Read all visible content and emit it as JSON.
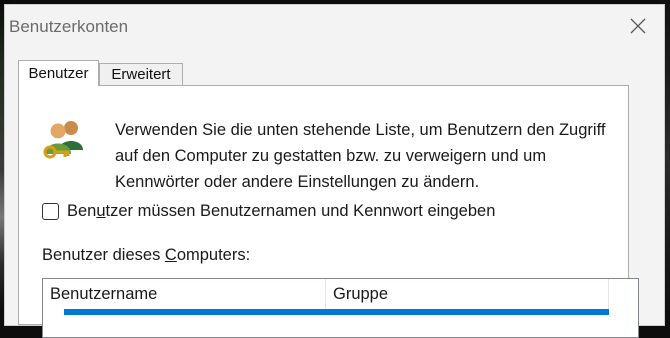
{
  "window": {
    "title": "Benutzerkonten",
    "close_icon": "close-icon"
  },
  "tabs": [
    {
      "label": "Benutzer",
      "selected": true
    },
    {
      "label": "Erweitert",
      "selected": false
    }
  ],
  "users_tab": {
    "intro_text": "Verwenden Sie die unten stehende Liste, um Benutzern den Zugriff auf den Computer zu gestatten bzw. zu verweigern und um Kennwörter oder andere Einstellungen zu ändern.",
    "require_login_checkbox": {
      "label_before": "Ben",
      "label_accel": "u",
      "label_after": "tzer müssen Benutzernamen und Kennwort eingeben",
      "checked": false
    },
    "list_label_before": "Benutzer dieses ",
    "list_label_accel": "C",
    "list_label_after": "omputers:",
    "list_columns": [
      "Benutzername",
      "Gruppe"
    ],
    "selection_color": "#0078d7"
  }
}
